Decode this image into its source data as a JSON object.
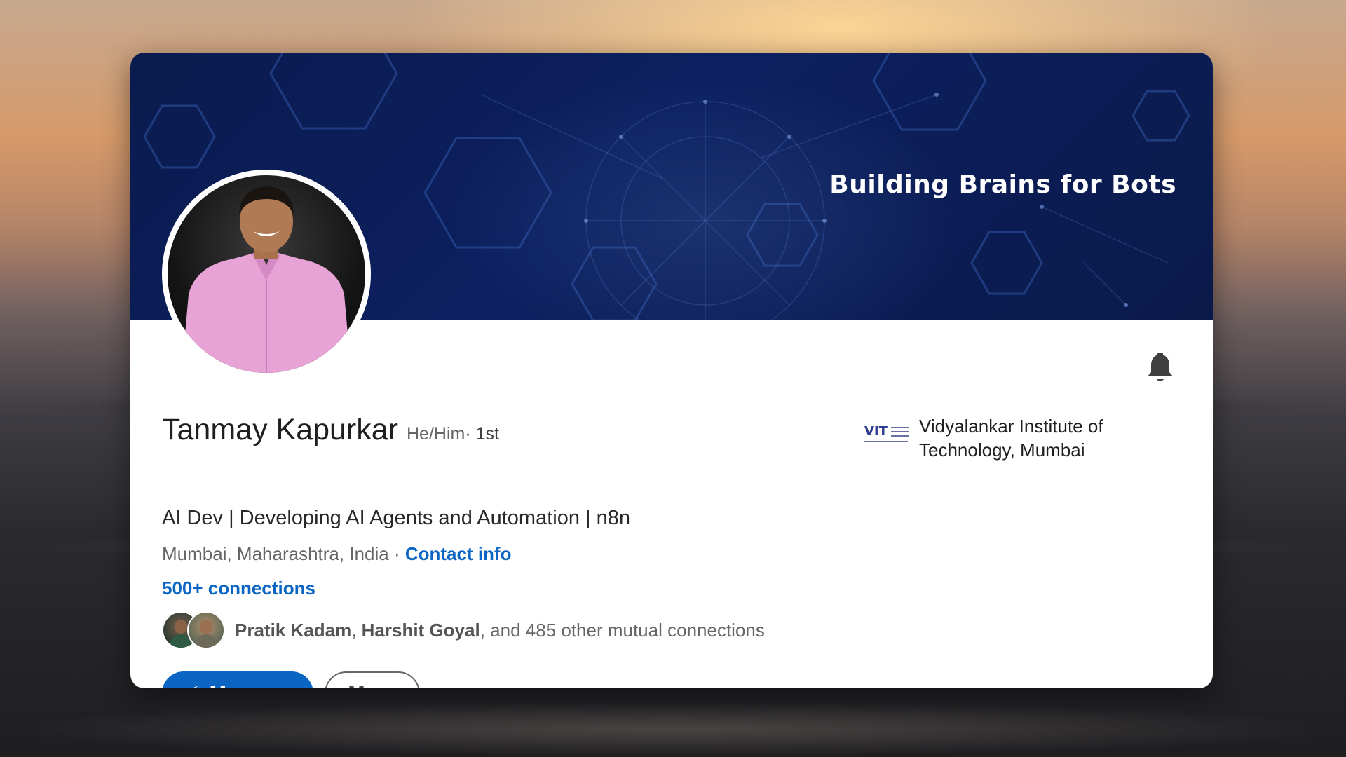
{
  "banner": {
    "tagline": "Building Brains for Bots"
  },
  "profile": {
    "name": "Tanmay Kapurkar",
    "pronouns": "He/Him",
    "degree": " · 1st",
    "headline": "AI Dev | Developing AI Agents and Automation | n8n",
    "location": "Mumbai, Maharashtra, India",
    "separator": " · ",
    "contact_info": "Contact info",
    "connections": "500+ connections",
    "mutual": {
      "person1": "Pratik Kadam",
      "comma": ", ",
      "person2": "Harshit Goyal",
      "rest": ", and 485 other mutual connections"
    }
  },
  "actions": {
    "message_label": "Message",
    "more_label": "More"
  },
  "education": {
    "logo_text": "VIT",
    "name": "Vidyalankar Institute of Technology, Mumbai"
  },
  "icons": {
    "bell": "bell-icon",
    "send": "send-icon"
  },
  "colors": {
    "accent": "#0a66c2",
    "banner": "#0c2060"
  }
}
